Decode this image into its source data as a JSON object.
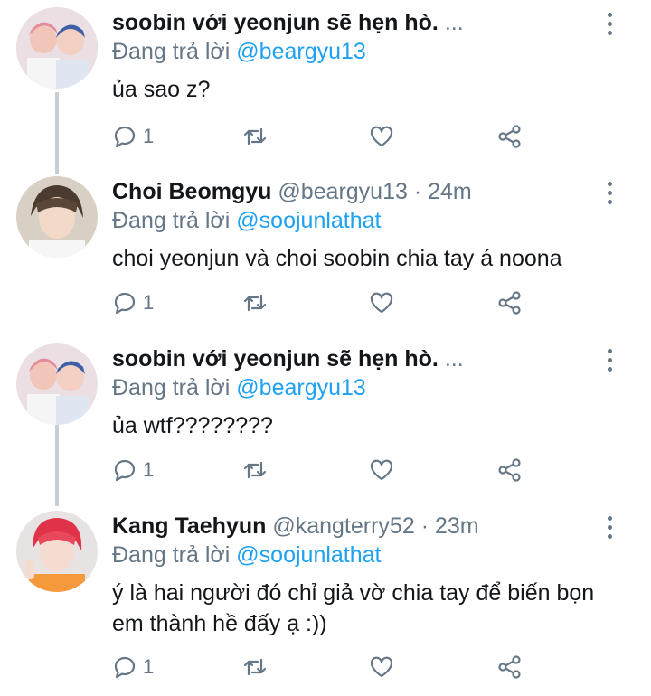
{
  "tweets": [
    {
      "name": "soobin với yeonjun sẽ hẹn hò.",
      "ellipsis": "...",
      "handle": "",
      "separator": "",
      "time": "",
      "reply_prefix": "Đang trả lời",
      "reply_to": "@beargyu13",
      "text": "ủa sao z?",
      "reply_count": "1",
      "avatar_icon": "avatar-photo-two-boys"
    },
    {
      "name": "Choi Beomgyu",
      "ellipsis": "",
      "handle": "@beargyu13",
      "separator": "·",
      "time": "24m",
      "reply_prefix": "Đang trả lời",
      "reply_to": "@soojunlathat",
      "text": "choi yeonjun và choi soobin chia tay á noona",
      "reply_count": "1",
      "avatar_icon": "avatar-photo-boy"
    },
    {
      "name": "soobin với yeonjun sẽ hẹn hò.",
      "ellipsis": "...",
      "handle": "",
      "separator": "",
      "time": "",
      "reply_prefix": "Đang trả lời",
      "reply_to": "@beargyu13",
      "text": "ủa wtf????????",
      "reply_count": "1",
      "avatar_icon": "avatar-photo-two-boys"
    },
    {
      "name": "Kang Taehyun",
      "ellipsis": "",
      "handle": "@kangterry52",
      "separator": "·",
      "time": "23m",
      "reply_prefix": "Đang trả lời",
      "reply_to": "@soojunlathat",
      "text": "ý là hai người đó chỉ giả vờ chia tay để biến bọn em thành hề đấy ạ :))",
      "reply_count": "1",
      "avatar_icon": "avatar-photo-red-hair"
    }
  ],
  "colors": {
    "text": "#14171a",
    "secondary": "#657786",
    "mention": "#1da1f2",
    "thread_line": "#c4cfd6"
  }
}
